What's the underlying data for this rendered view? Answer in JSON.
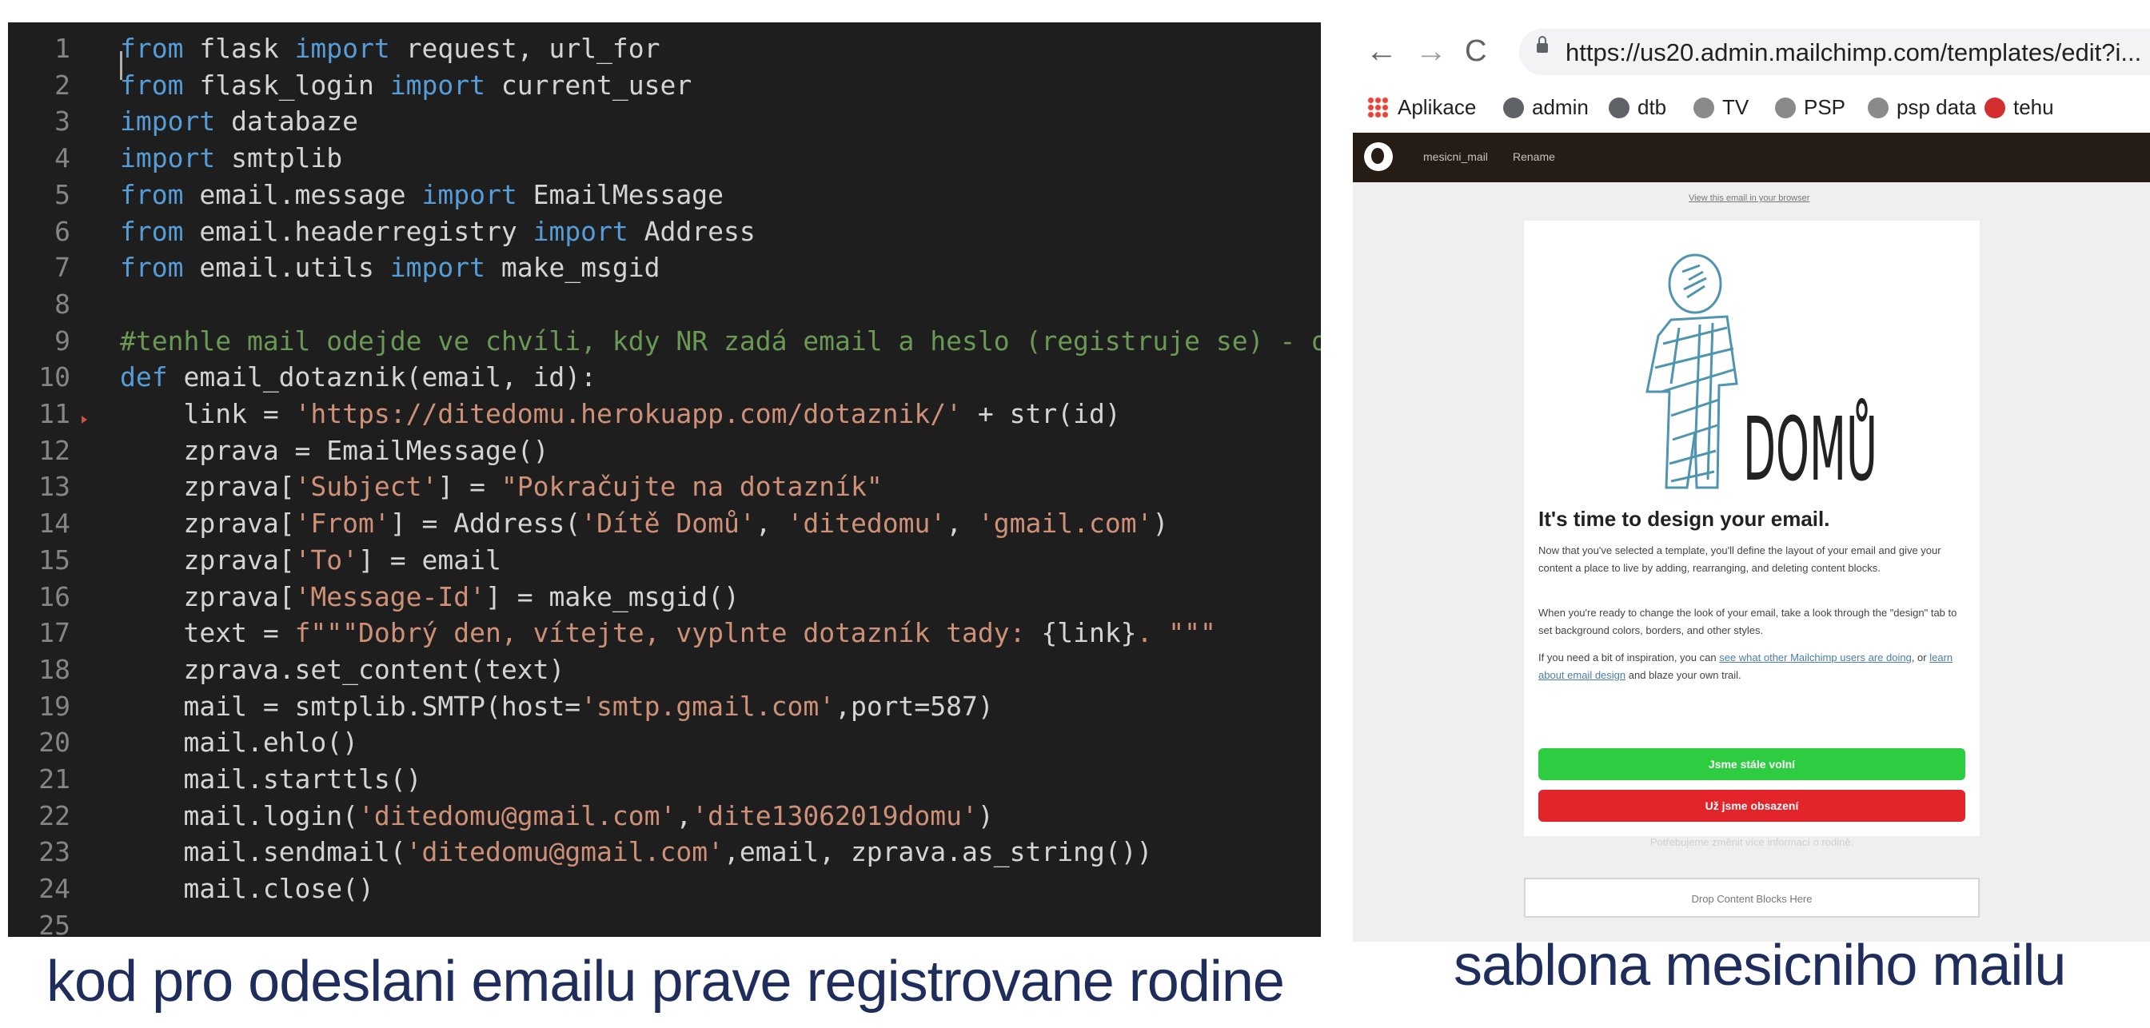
{
  "editor": {
    "lines": [
      {
        "n": "1",
        "tokens": [
          [
            "kw",
            "from"
          ],
          [
            "t",
            " flask "
          ],
          [
            "kw",
            "import"
          ],
          [
            "t",
            " request, url_for"
          ]
        ]
      },
      {
        "n": "2",
        "tokens": [
          [
            "kw",
            "from"
          ],
          [
            "t",
            " flask_login "
          ],
          [
            "kw",
            "import"
          ],
          [
            "t",
            " current_user"
          ]
        ]
      },
      {
        "n": "3",
        "tokens": [
          [
            "kw",
            "import"
          ],
          [
            "t",
            " databaze"
          ]
        ]
      },
      {
        "n": "4",
        "tokens": [
          [
            "kw",
            "import"
          ],
          [
            "t",
            " smtplib"
          ]
        ]
      },
      {
        "n": "5",
        "tokens": [
          [
            "kw",
            "from"
          ],
          [
            "t",
            " email.message "
          ],
          [
            "kw",
            "import"
          ],
          [
            "t",
            " EmailMessage"
          ]
        ]
      },
      {
        "n": "6",
        "tokens": [
          [
            "kw",
            "from"
          ],
          [
            "t",
            " email.headerregistry "
          ],
          [
            "kw",
            "import"
          ],
          [
            "t",
            " Address"
          ]
        ]
      },
      {
        "n": "7",
        "tokens": [
          [
            "kw",
            "from"
          ],
          [
            "t",
            " email.utils "
          ],
          [
            "kw",
            "import"
          ],
          [
            "t",
            " make_msgid"
          ]
        ]
      },
      {
        "n": "8",
        "tokens": []
      },
      {
        "n": "9",
        "tokens": [
          [
            "cm",
            "#tenhle mail odejde ve chvíli, kdy NR zadá email a heslo (registruje se) - odkaz"
          ]
        ]
      },
      {
        "n": "10",
        "tokens": [
          [
            "kw",
            "def"
          ],
          [
            "t",
            " email_dotaznik(email, id):"
          ]
        ]
      },
      {
        "n": "11",
        "tokens": [
          [
            "ws",
            "    "
          ],
          [
            "t",
            "link = "
          ],
          [
            "str",
            "'https://ditedomu.herokuapp.com/dotaznik/'"
          ],
          [
            "t",
            " + str(id)"
          ]
        ]
      },
      {
        "n": "12",
        "tokens": [
          [
            "ws",
            "    "
          ],
          [
            "t",
            "zprava = EmailMessage()"
          ]
        ]
      },
      {
        "n": "13",
        "tokens": [
          [
            "ws",
            "    "
          ],
          [
            "t",
            "zprava["
          ],
          [
            "str",
            "'Subject'"
          ],
          [
            "t",
            "] = "
          ],
          [
            "str",
            "\"Pokračujte na dotazník\""
          ]
        ]
      },
      {
        "n": "14",
        "tokens": [
          [
            "ws",
            "    "
          ],
          [
            "t",
            "zprava["
          ],
          [
            "str",
            "'From'"
          ],
          [
            "t",
            "] = Address("
          ],
          [
            "str",
            "'Dítě Domů'"
          ],
          [
            "t",
            ", "
          ],
          [
            "str",
            "'ditedomu'"
          ],
          [
            "t",
            ", "
          ],
          [
            "str",
            "'gmail.com'"
          ],
          [
            "t",
            ")"
          ]
        ]
      },
      {
        "n": "15",
        "tokens": [
          [
            "ws",
            "    "
          ],
          [
            "t",
            "zprava["
          ],
          [
            "str",
            "'To'"
          ],
          [
            "t",
            "] = email"
          ]
        ]
      },
      {
        "n": "16",
        "tokens": [
          [
            "ws",
            "    "
          ],
          [
            "t",
            "zprava["
          ],
          [
            "str",
            "'Message-Id'"
          ],
          [
            "t",
            "] = make_msgid()"
          ]
        ]
      },
      {
        "n": "17",
        "tokens": [
          [
            "ws",
            "    "
          ],
          [
            "t",
            "text = "
          ],
          [
            "str",
            "f\"\"\"Dobrý den, vítejte, vyplnte dotazník tady: "
          ],
          [
            "t",
            "{link}"
          ],
          [
            "str",
            ". \"\"\""
          ]
        ]
      },
      {
        "n": "18",
        "tokens": [
          [
            "ws",
            "    "
          ],
          [
            "t",
            "zprava.set_content(text)"
          ]
        ]
      },
      {
        "n": "19",
        "tokens": [
          [
            "ws",
            "    "
          ],
          [
            "t",
            "mail = smtplib.SMTP(host="
          ],
          [
            "str",
            "'smtp.gmail.com'"
          ],
          [
            "t",
            ",port=587)"
          ]
        ]
      },
      {
        "n": "20",
        "tokens": [
          [
            "ws",
            "    "
          ],
          [
            "t",
            "mail.ehlo()"
          ]
        ]
      },
      {
        "n": "21",
        "tokens": [
          [
            "ws",
            "    "
          ],
          [
            "t",
            "mail.starttls()"
          ]
        ]
      },
      {
        "n": "22",
        "tokens": [
          [
            "ws",
            "    "
          ],
          [
            "t",
            "mail.login("
          ],
          [
            "str",
            "'ditedomu@gmail.com'"
          ],
          [
            "t",
            ","
          ],
          [
            "str",
            "'dite13062019domu'"
          ],
          [
            "t",
            ")"
          ]
        ]
      },
      {
        "n": "23",
        "tokens": [
          [
            "ws",
            "    "
          ],
          [
            "t",
            "mail.sendmail("
          ],
          [
            "str",
            "'ditedomu@gmail.com'"
          ],
          [
            "t",
            ",email, zprava.as_string())"
          ]
        ]
      },
      {
        "n": "24",
        "tokens": [
          [
            "ws",
            "    "
          ],
          [
            "t",
            "mail.close()"
          ]
        ]
      },
      {
        "n": "25",
        "tokens": []
      }
    ]
  },
  "captions": {
    "left": "kod pro odeslani emailu prave registrovane rodine",
    "right": "sablona mesicniho mailu"
  },
  "browser": {
    "back_icon": "←",
    "forward_icon": "→",
    "reload_icon": "C",
    "url": "https://us20.admin.mailchimp.com/templates/edit?i...",
    "zoom_icon": "zoom-icon",
    "bookmarks": [
      {
        "label": "Aplikace",
        "color": "#ea4335"
      },
      {
        "label": "admin",
        "color": "#5f6368"
      },
      {
        "label": "dtb",
        "color": "#5f6368"
      },
      {
        "label": "TV",
        "color": "#8a8a8a"
      },
      {
        "label": "PSP",
        "color": "#8a8a8a"
      },
      {
        "label": "psp data",
        "color": "#8a8a8a"
      },
      {
        "label": "tehu",
        "color": "#d32f2f"
      }
    ]
  },
  "mailchimp": {
    "tab_name": "mesicni_mail",
    "rename": "Rename",
    "view_in_browser": "View this email in your browser",
    "logo_text": "DOMŮ",
    "heading": "It's time to design your email.",
    "p1": "Now that you've selected a template, you'll define the layout of your email and give your content a place to live by adding, rearranging, and deleting content blocks.",
    "p2": "When you're ready to change the look of your email, take a look through the \"design\" tab to set background colors, borders, and other styles.",
    "p3_a": "If you need a bit of inspiration, you can ",
    "p3_link1": "see what other Mailchimp users are doing",
    "p3_b": ", or ",
    "p3_link2": "learn about email design",
    "p3_c": " and blaze your own trail.",
    "btn_green": "Jsme stále volní",
    "btn_red": "Už jsme obsazení",
    "footer_link": "Potřebujeme změnit více informací o rodině.",
    "drop_zone": "Drop Content Blocks Here"
  }
}
